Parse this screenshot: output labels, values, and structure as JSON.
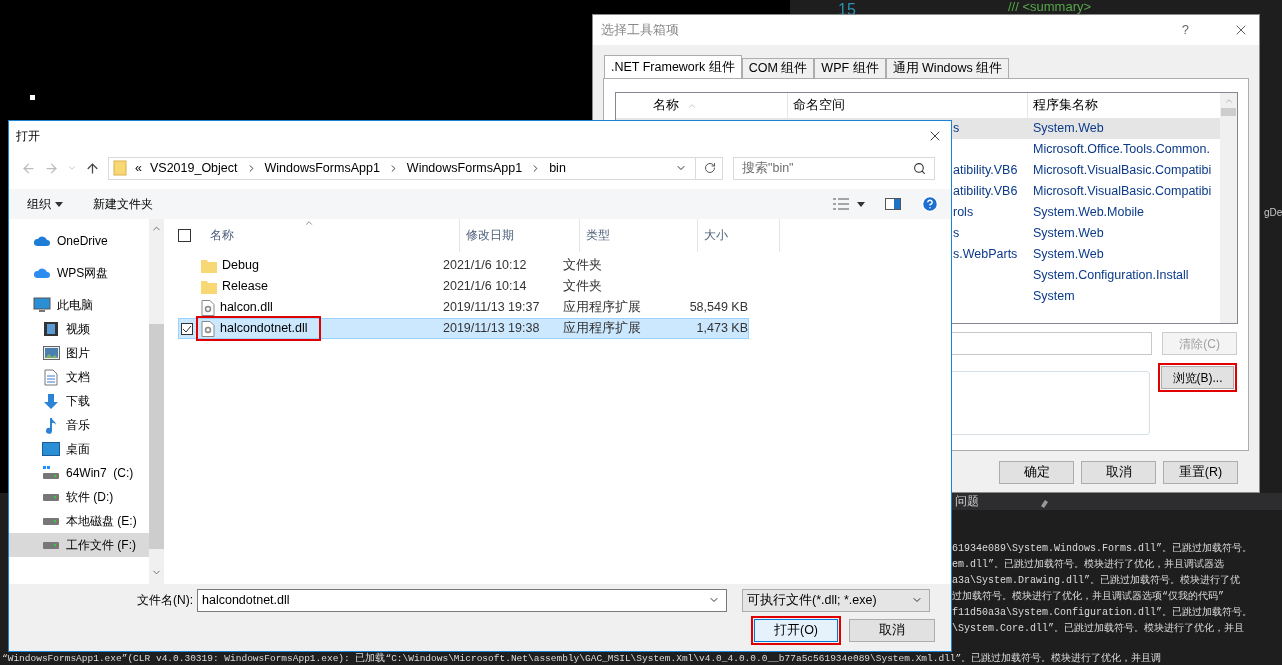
{
  "editor": {
    "line_number": "15",
    "code": "/// <summary>",
    "fragment": "gDe"
  },
  "toolbox_dialog": {
    "title": "选择工具箱项",
    "help": "?",
    "tabs": [
      {
        "label": ".NET Framework 组件",
        "selected": true
      },
      {
        "label": "COM 组件",
        "selected": false
      },
      {
        "label": "WPF 组件",
        "selected": false
      },
      {
        "label": "通用 Windows 组件",
        "selected": false
      }
    ],
    "columns": [
      "名称",
      "命名空间",
      "程序集名称"
    ],
    "rows": [
      {
        "namespace": "s",
        "assembly": "System.Web",
        "selected": true
      },
      {
        "assembly": "Microsoft.Office.Tools.Common.",
        "selected": false
      },
      {
        "namespace": "atibility.VB6",
        "assembly": "Microsoft.VisualBasic.Compatibi",
        "selected": false
      },
      {
        "namespace": "atibility.VB6",
        "assembly": "Microsoft.VisualBasic.Compatibi",
        "selected": false
      },
      {
        "namespace": "rols",
        "assembly": "System.Web.Mobile",
        "selected": false
      },
      {
        "namespace": "s",
        "assembly": "System.Web",
        "selected": false
      },
      {
        "namespace": "s.WebParts",
        "assembly": "System.Web",
        "selected": false
      },
      {
        "assembly": "System.Configuration.Install",
        "selected": false
      },
      {
        "assembly": "System",
        "selected": false
      }
    ],
    "clear_button": {
      "label": "清除(C)",
      "disabled": true
    },
    "browse_button": {
      "label": "浏览(B)...",
      "highlighted": true
    },
    "actions": [
      "确定",
      "取消",
      "重置(R)"
    ]
  },
  "output": {
    "tab": "问题",
    "lines": [
      "61934e089\\System.Windows.Forms.dll”。已跳过加载符号。",
      "em.dll”。已跳过加载符号。模块进行了优化，并且调试器选",
      "a3a\\System.Drawing.dll”。已跳过加载符号。模块进行了优",
      "过加载符号。模块进行了优化，并且调试器选项“仅我的代码”",
      "f11d50a3a\\System.Configuration.dll”。已跳过加载符号。",
      "\\System.Core.dll”。已跳过加载符号。模块进行了优化，并且"
    ],
    "last_line": "“WindowsFormsApp1.exe”(CLR v4.0.30319: WindowsFormsApp1.exe): 已加载“C:\\Windows\\Microsoft.Net\\assembly\\GAC_MSIL\\System.Xml\\v4.0_4.0.0.0__b77a5c561934e089\\System.Xml.dll”。已跳过加载符号。模块进行了优化，并且调"
  },
  "open_dialog": {
    "title": "打开",
    "breadcrumb_prefix": "«",
    "path": [
      "VS2019_Object",
      "WindowsFormsApp1",
      "WindowsFormsApp1",
      "bin"
    ],
    "search": {
      "placeholder": "搜索\"bin\""
    },
    "toolbar": {
      "organize": "组织",
      "new_folder": "新建文件夹"
    },
    "nav": [
      {
        "label": "OneDrive",
        "kind": "cloud",
        "selected": false
      },
      {
        "label": "WPS网盘",
        "kind": "wps",
        "selected": false
      },
      {
        "label": "此电脑",
        "kind": "pc",
        "selected": false,
        "children": [
          {
            "label": "视频",
            "kind": "video",
            "selected": false
          },
          {
            "label": "图片",
            "kind": "picture",
            "selected": false
          },
          {
            "label": "文档",
            "kind": "doc",
            "selected": false
          },
          {
            "label": "下载",
            "kind": "download",
            "selected": false
          },
          {
            "label": "音乐",
            "kind": "music",
            "selected": false
          },
          {
            "label": "桌面",
            "kind": "desktop",
            "selected": false
          },
          {
            "label": "64Win7  (C:)",
            "kind": "system-drive",
            "selected": false
          },
          {
            "label": "软件 (D:)",
            "kind": "drive",
            "selected": false
          },
          {
            "label": "本地磁盘 (E:)",
            "kind": "drive",
            "selected": false
          },
          {
            "label": "工作文件 (F:)",
            "kind": "drive",
            "selected": true
          }
        ]
      }
    ],
    "columns": [
      "名称",
      "修改日期",
      "类型",
      "大小"
    ],
    "select_all_checked": false,
    "files": [
      {
        "name": "Debug",
        "kind": "folder",
        "date": "2021/1/6 10:12",
        "type": "文件夹",
        "selected": false,
        "highlighted": false
      },
      {
        "name": "Release",
        "kind": "folder",
        "date": "2021/1/6 10:14",
        "type": "文件夹",
        "selected": false,
        "highlighted": false
      },
      {
        "name": "halcon.dll",
        "kind": "file",
        "date": "2019/11/13 19:37",
        "type": "应用程序扩展",
        "size": "58,549 KB",
        "selected": false,
        "highlighted": false
      },
      {
        "name": "halcondotnet.dll",
        "kind": "file",
        "date": "2019/11/13 19:38",
        "type": "应用程序扩展",
        "size": "1,473 KB",
        "selected": true,
        "highlighted": true
      }
    ],
    "filename_label": "文件名(N):",
    "filename": "halcondotnet.dll",
    "filter": "可执行文件(*.dll; *.exe)",
    "open_button": {
      "label": "打开(O)",
      "highlighted": true
    },
    "cancel_button": "取消"
  }
}
